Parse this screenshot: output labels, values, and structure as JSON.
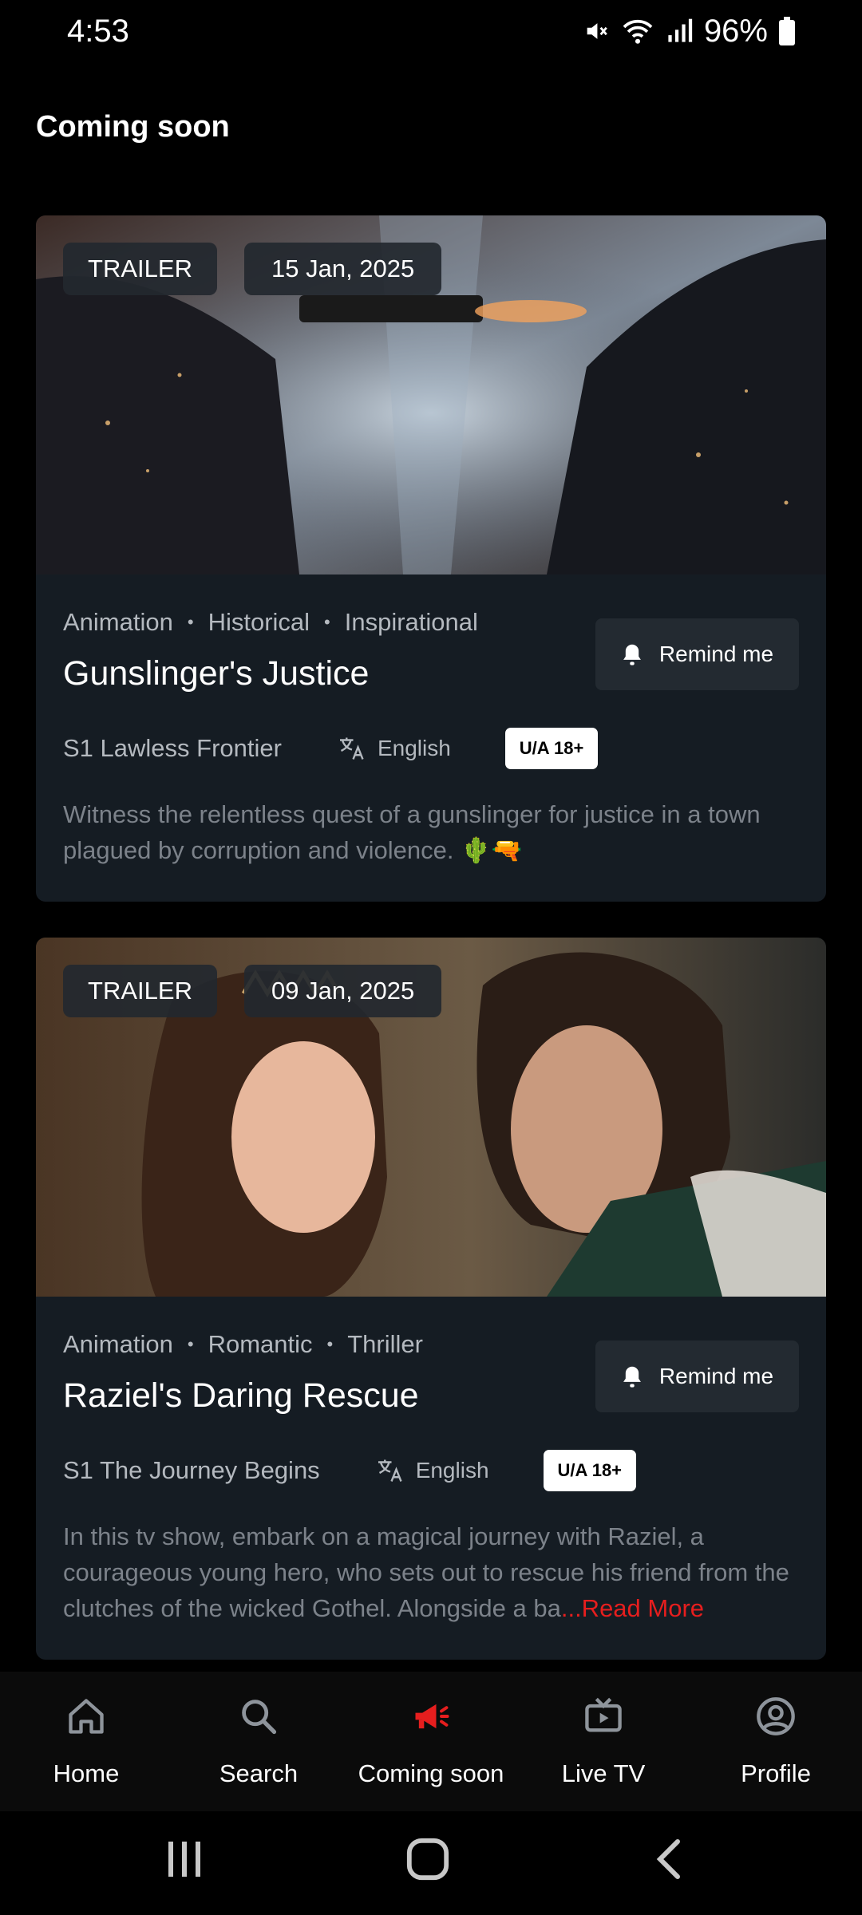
{
  "status": {
    "time": "4:53",
    "battery": "96%",
    "icons": [
      "mute-icon",
      "wifi-icon",
      "signal-icon",
      "battery-icon"
    ]
  },
  "page": {
    "title": "Coming soon"
  },
  "cards": [
    {
      "badge": "TRAILER",
      "date": "15 Jan, 2025",
      "genres": [
        "Animation",
        "Historical",
        "Inspirational"
      ],
      "title": "Gunslinger's Justice",
      "remind_label": "Remind me",
      "episode": "S1 Lawless Frontier",
      "language": "English",
      "rating": "U/A 18+",
      "description": "Witness the relentless quest of a gunslinger for justice in a town plagued by corruption and violence. 🌵🔫",
      "read_more": ""
    },
    {
      "badge": "TRAILER",
      "date": "09 Jan, 2025",
      "genres": [
        "Animation",
        "Romantic",
        "Thriller"
      ],
      "title": "Raziel's Daring Rescue",
      "remind_label": "Remind me",
      "episode": "S1 The Journey Begins",
      "language": "English",
      "rating": "U/A 18+",
      "description": "In this tv show, embark on a magical journey with Raziel, a courageous young hero, who sets out to rescue his friend from the clutches of the wicked Gothel. Alongside a ba",
      "read_more": "...Read More"
    }
  ],
  "nav": {
    "items": [
      {
        "label": "Home",
        "icon": "home-icon"
      },
      {
        "label": "Search",
        "icon": "search-icon"
      },
      {
        "label": "Coming soon",
        "icon": "megaphone-icon",
        "active": true
      },
      {
        "label": "Live TV",
        "icon": "tv-icon"
      },
      {
        "label": "Profile",
        "icon": "profile-icon"
      }
    ]
  },
  "colors": {
    "background": "#000000",
    "card": "#151c23",
    "accent": "#e61e1e",
    "muted_text": "#b4b9bf"
  }
}
